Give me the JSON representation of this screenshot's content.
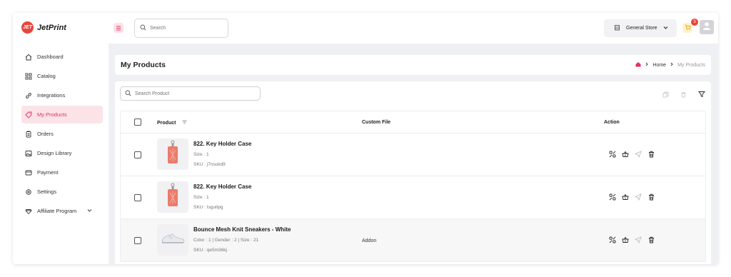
{
  "app": {
    "logo_text": "JetPrint",
    "logo_mark": "JET"
  },
  "sidebar": {
    "items": [
      {
        "label": "Dashboard",
        "icon": "home-icon"
      },
      {
        "label": "Catalog",
        "icon": "grid-icon"
      },
      {
        "label": "Integrations",
        "icon": "link-icon"
      },
      {
        "label": "My Products",
        "icon": "tag-icon",
        "active": true
      },
      {
        "label": "Orders",
        "icon": "clipboard-icon"
      },
      {
        "label": "Design Library",
        "icon": "image-icon"
      },
      {
        "label": "Payment",
        "icon": "card-icon"
      },
      {
        "label": "Settings",
        "icon": "gear-icon"
      },
      {
        "label": "Affiliate Program",
        "icon": "diamond-icon",
        "has_chevron": true
      }
    ]
  },
  "topbar": {
    "search_placeholder": "Search",
    "store_name": "General Store",
    "cart_count": "3"
  },
  "page": {
    "title": "My Products",
    "breadcrumb": {
      "home": "Home",
      "current": "My Products"
    }
  },
  "products": {
    "search_placeholder": "Search Product",
    "columns": {
      "product": "Product",
      "custom_file": "Custom File",
      "action": "Action"
    },
    "rows": [
      {
        "name": "822. Key Holder Case",
        "meta1": "Size : 1",
        "meta2": "SKU : j7nsukd9",
        "custom_file": "",
        "thumb": "keyholder"
      },
      {
        "name": "822. Key Holder Case",
        "meta1": "Size : 1",
        "meta2": "SKU : tsgultpg",
        "custom_file": "",
        "thumb": "keyholder"
      },
      {
        "name": "Bounce Mesh Knit Sneakers - White",
        "meta1": "Color : 1 | Gender : 2 | Size : 21",
        "meta2": "SKU : qe5m36kj",
        "custom_file": "Addon",
        "thumb": "sneaker"
      }
    ]
  },
  "colors": {
    "accent": "#e0325f",
    "accent_bg": "#fbe3e8",
    "badge": "#e8453c",
    "cart_bg": "#fdf3cf",
    "page_bg": "#eef0f4"
  }
}
